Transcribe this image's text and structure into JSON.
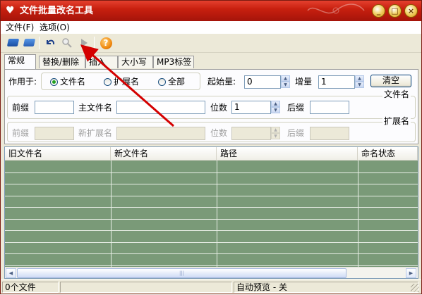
{
  "window": {
    "title": "文件批量改名工具",
    "app_icon": "heart-icon",
    "accent": "#c8200f",
    "controls": {
      "minimize": "_",
      "maximize": "□",
      "close": "×"
    }
  },
  "menu": [
    "文件(F)",
    "选项(O)"
  ],
  "toolbar": {
    "icons": [
      "open-folder-icon",
      "save-folder-icon",
      "undo-icon",
      "preview-search-icon",
      "run-icon",
      "help-icon"
    ],
    "help_glyph": "?"
  },
  "tabs": [
    "常规",
    "替换/删除",
    "插入",
    "大小写",
    "MP3标签"
  ],
  "general": {
    "apply_to_label": "作用于:",
    "radios": [
      {
        "label": "文件名",
        "checked": true
      },
      {
        "label": "扩展名",
        "checked": false
      },
      {
        "label": "全部",
        "checked": false
      }
    ],
    "start_label": "起始量:",
    "start_value": "0",
    "step_label": "增量",
    "step_value": "1",
    "clear_button": "清空",
    "filename_group": {
      "title": "文件名",
      "prefix_label": "前缀",
      "prefix_value": "",
      "main_label": "主文件名",
      "main_value": "",
      "digits_label": "位数",
      "digits_value": "1",
      "suffix_label": "后缀",
      "suffix_value": ""
    },
    "ext_group": {
      "title": "扩展名",
      "prefix_label": "前缀",
      "new_ext_label": "新扩展名",
      "digits_label": "位数",
      "suffix_label": "后缀"
    }
  },
  "list": {
    "columns": [
      "旧文件名",
      "新文件名",
      "路径",
      "命名状态"
    ],
    "rows": [],
    "background": "#7a9a78"
  },
  "status": {
    "file_count": "0个文件",
    "middle": "",
    "preview": "自动预览 - 关"
  },
  "annotation": {
    "color": "#d40000"
  }
}
